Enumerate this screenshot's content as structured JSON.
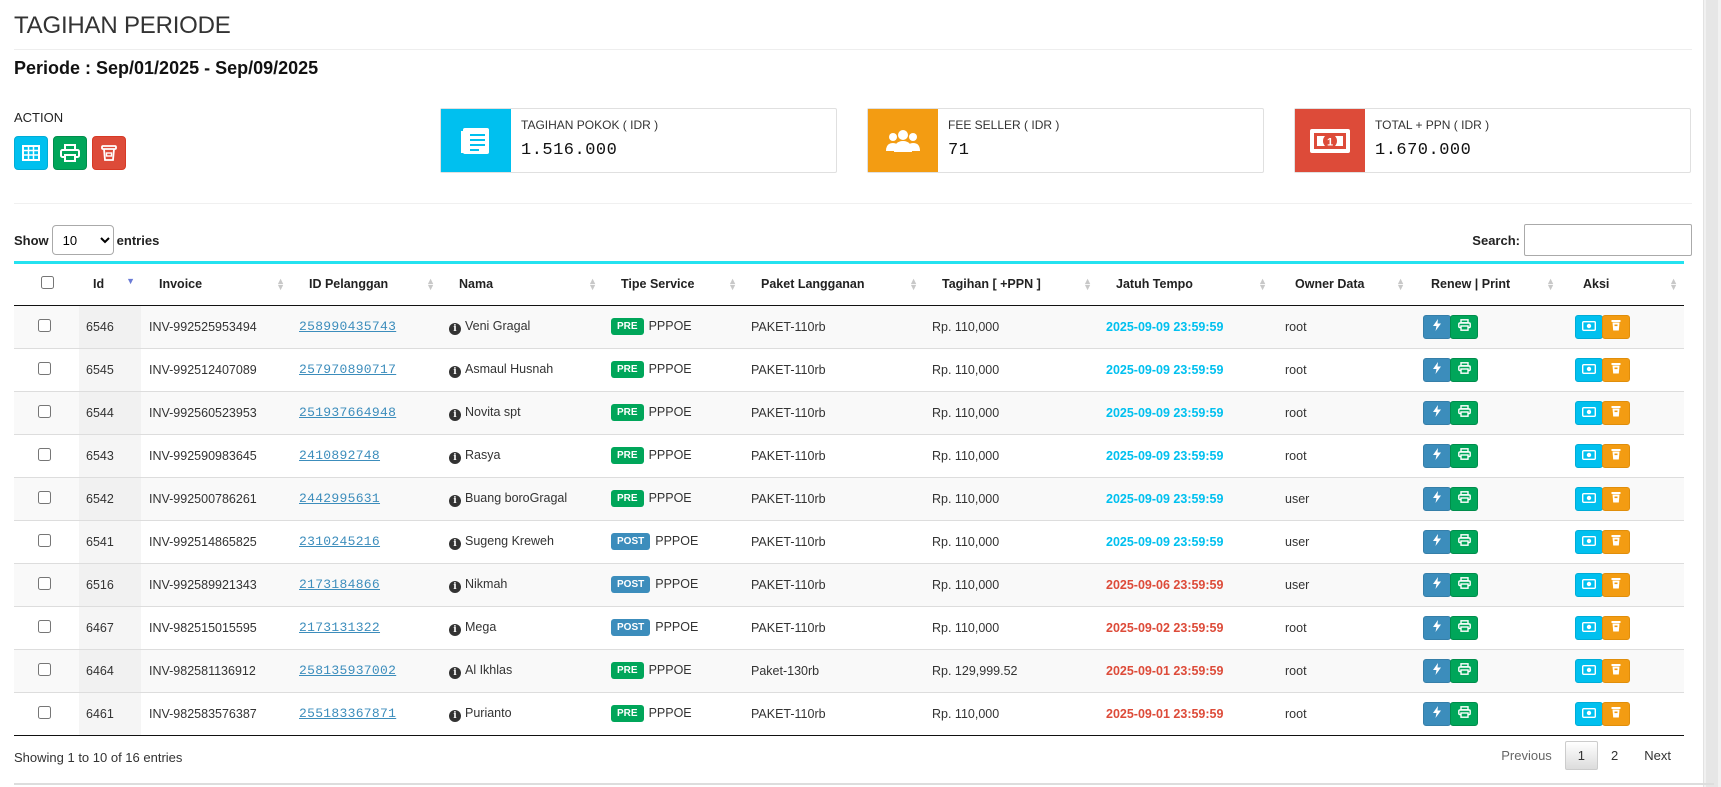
{
  "page": {
    "title": "TAGIHAN PERIODE",
    "periode": "Periode : Sep/01/2025 - Sep/09/2025",
    "action_label": "ACTION"
  },
  "action_buttons": [
    {
      "icon": "table-icon",
      "color": "#00c0ef"
    },
    {
      "icon": "print-icon",
      "color": "#00a65a"
    },
    {
      "icon": "trash-icon",
      "color": "#dd4b39"
    }
  ],
  "info_boxes": [
    {
      "label": "TAGIHAN POKOK ( IDR )",
      "value": "1.516.000",
      "color": "#00c0ef",
      "icon": "document-list-icon"
    },
    {
      "label": "FEE SELLER ( IDR )",
      "value": "71",
      "color": "#f39c12",
      "icon": "users-icon"
    },
    {
      "label": "TOTAL + PPN ( IDR )",
      "value": "1.670.000",
      "color": "#dd4b39",
      "icon": "money-icon"
    }
  ],
  "controls": {
    "show_label": "Show",
    "entries_value": "10",
    "entries_label": "entries",
    "search_label": "Search:",
    "search_value": ""
  },
  "columns": [
    "Id",
    "Invoice",
    "ID Pelanggan",
    "Nama",
    "Tipe Service",
    "Paket Langganan",
    "Tagihan [ +PPN ]",
    "Jatuh Tempo",
    "Owner Data",
    "Renew | Print",
    "Aksi"
  ],
  "rows": [
    {
      "id": "6546",
      "invoice": "INV-992525953494",
      "customer_id": "258990435743",
      "name": "Veni Gragal",
      "type": "PRE",
      "service": "PPPOE",
      "package": "PAKET-110rb",
      "amount": "Rp. 110,000",
      "due": "2025-09-09 23:59:59",
      "due_status": "cyan",
      "owner": "root"
    },
    {
      "id": "6545",
      "invoice": "INV-992512407089",
      "customer_id": "257970890717",
      "name": "Asmaul Husnah",
      "type": "PRE",
      "service": "PPPOE",
      "package": "PAKET-110rb",
      "amount": "Rp. 110,000",
      "due": "2025-09-09 23:59:59",
      "due_status": "cyan",
      "owner": "root"
    },
    {
      "id": "6544",
      "invoice": "INV-992560523953",
      "customer_id": "251937664948",
      "name": "Novita spt",
      "type": "PRE",
      "service": "PPPOE",
      "package": "PAKET-110rb",
      "amount": "Rp. 110,000",
      "due": "2025-09-09 23:59:59",
      "due_status": "cyan",
      "owner": "root"
    },
    {
      "id": "6543",
      "invoice": "INV-992590983645",
      "customer_id": "2410892748",
      "name": "Rasya",
      "type": "PRE",
      "service": "PPPOE",
      "package": "PAKET-110rb",
      "amount": "Rp. 110,000",
      "due": "2025-09-09 23:59:59",
      "due_status": "cyan",
      "owner": "root"
    },
    {
      "id": "6542",
      "invoice": "INV-992500786261",
      "customer_id": "2442995631",
      "name": "Buang boroGragal",
      "type": "PRE",
      "service": "PPPOE",
      "package": "PAKET-110rb",
      "amount": "Rp. 110,000",
      "due": "2025-09-09 23:59:59",
      "due_status": "cyan",
      "owner": "user"
    },
    {
      "id": "6541",
      "invoice": "INV-992514865825",
      "customer_id": "2310245216",
      "name": "Sugeng Kreweh",
      "type": "POST",
      "service": "PPPOE",
      "package": "PAKET-110rb",
      "amount": "Rp. 110,000",
      "due": "2025-09-09 23:59:59",
      "due_status": "cyan",
      "owner": "user"
    },
    {
      "id": "6516",
      "invoice": "INV-992589921343",
      "customer_id": "2173184866",
      "name": "Nikmah",
      "type": "POST",
      "service": "PPPOE",
      "package": "PAKET-110rb",
      "amount": "Rp. 110,000",
      "due": "2025-09-06 23:59:59",
      "due_status": "red",
      "owner": "user"
    },
    {
      "id": "6467",
      "invoice": "INV-982515015595",
      "customer_id": "2173131322",
      "name": "Mega",
      "type": "POST",
      "service": "PPPOE",
      "package": "PAKET-110rb",
      "amount": "Rp. 110,000",
      "due": "2025-09-02 23:59:59",
      "due_status": "red",
      "owner": "root"
    },
    {
      "id": "6464",
      "invoice": "INV-982581136912",
      "customer_id": "258135937002",
      "name": "Al Ikhlas",
      "type": "PRE",
      "service": "PPPOE",
      "package": "Paket-130rb",
      "amount": "Rp. 129,999.52",
      "due": "2025-09-01 23:59:59",
      "due_status": "red",
      "owner": "root"
    },
    {
      "id": "6461",
      "invoice": "INV-982583576387",
      "customer_id": "255183367871",
      "name": "Purianto",
      "type": "PRE",
      "service": "PPPOE",
      "package": "PAKET-110rb",
      "amount": "Rp. 110,000",
      "due": "2025-09-01 23:59:59",
      "due_status": "red",
      "owner": "root"
    }
  ],
  "footer": {
    "info": "Showing 1 to 10 of 16 entries",
    "previous": "Previous",
    "pages": [
      "1",
      "2"
    ],
    "current_page": "1",
    "next": "Next"
  }
}
